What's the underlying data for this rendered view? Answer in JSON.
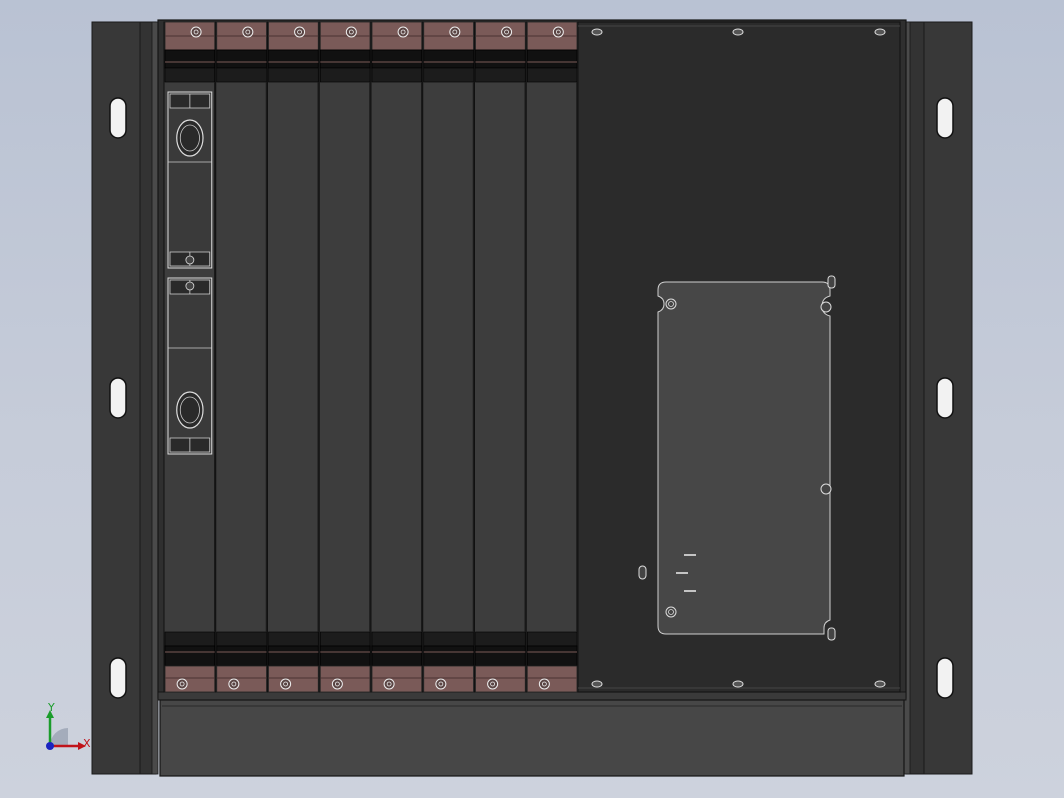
{
  "viewport": {
    "background_top": "#b9c2d3",
    "background_bottom": "#cdd2dd"
  },
  "chassis": {
    "card_slots": 8,
    "cards_with_handles": 1,
    "body_color": "#3d3d3d",
    "dark_color": "#2a2a2a",
    "latch_color": "#7a5a58",
    "blank_panel_color": "#2e2e2e",
    "inner_plate_color": "#4a4a4a"
  },
  "triad": {
    "x_label": "X",
    "y_label": "Y",
    "x_color": "#c0131a",
    "y_color": "#1a9c2a",
    "z_color": "#1a24c0"
  }
}
